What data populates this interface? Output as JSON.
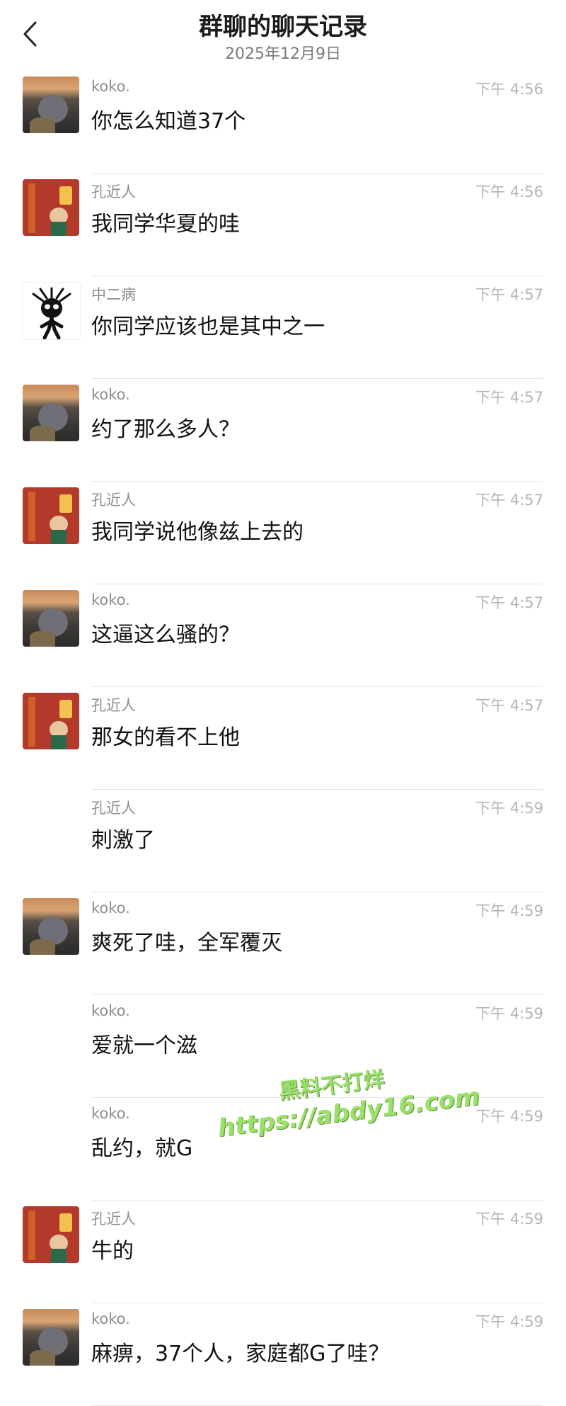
{
  "header": {
    "title": "群聊的聊天记录",
    "date": "2025年12月9日"
  },
  "messages": [
    {
      "sender": "koko.",
      "time": "下午 4:56",
      "text": "你怎么知道37个",
      "avatar": "koko"
    },
    {
      "sender": "孔近人",
      "time": "下午 4:56",
      "text": "我同学华夏的哇",
      "avatar": "kong"
    },
    {
      "sender": "中二病",
      "time": "下午 4:57",
      "text": "你同学应该也是其中之一",
      "avatar": "zhong"
    },
    {
      "sender": "koko.",
      "time": "下午 4:57",
      "text": "约了那么多人？",
      "avatar": "koko"
    },
    {
      "sender": "孔近人",
      "time": "下午 4:57",
      "text": "我同学说他像兹上去的",
      "avatar": "kong"
    },
    {
      "sender": "koko.",
      "time": "下午 4:57",
      "text": "这逼这么骚的？",
      "avatar": "koko"
    },
    {
      "sender": "孔近人",
      "time": "下午 4:57",
      "text": "那女的看不上他",
      "avatar": "kong"
    },
    {
      "sender": "孔近人",
      "time": "下午 4:59",
      "text": "刺激了",
      "avatar": ""
    },
    {
      "sender": "koko.",
      "time": "下午 4:59",
      "text": "爽死了哇，全军覆灭",
      "avatar": "koko"
    },
    {
      "sender": "koko.",
      "time": "下午 4:59",
      "text": "爱就一个滋",
      "avatar": ""
    },
    {
      "sender": "koko.",
      "time": "下午 4:59",
      "text": "乱约，就G",
      "avatar": ""
    },
    {
      "sender": "孔近人",
      "time": "下午 4:59",
      "text": "牛的",
      "avatar": "kong"
    },
    {
      "sender": "koko.",
      "time": "下午 4:59",
      "text": "麻痹，37个人，家庭都G了哇？",
      "avatar": "koko"
    }
  ],
  "watermark": {
    "line1": "黑料不打烊",
    "line2": "https://abdy16.com"
  }
}
